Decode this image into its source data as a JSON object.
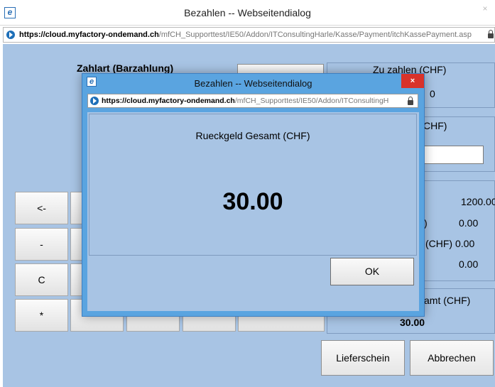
{
  "outer_window": {
    "title": "Bezahlen -- Webseitendialog",
    "close_glyph": "×",
    "url_domain": "https://cloud.myfactory-ondemand.ch",
    "url_path": "/mfCH_Supporttest/IE50/Addon/ITConsultingHarle/Kasse/Payment/itchKassePayment.asp"
  },
  "payment": {
    "payment_type_title": "Zahlart (Barzahlung)",
    "amount_due_label": "Zu zahlen (CHF)",
    "amount_due_value_partial": "0",
    "amount_received_label_partial": "CHF)",
    "summary_value_1": "1200.00",
    "summary_label_2_partial": ")",
    "summary_value_2": "0.00",
    "summary_label_3_partial": "(CHF) 0.00",
    "summary_value_4": "0.00",
    "change_total_label_partial": "amt (CHF)",
    "change_total_value": "30.00",
    "keypad": {
      "backspace": "<-",
      "minus": "-",
      "clear": "C",
      "multiply": "*"
    },
    "delivery_note_button": "Lieferschein",
    "cancel_button": "Abbrechen"
  },
  "inner_dialog": {
    "title": "Bezahlen -- Webseitendialog",
    "close_glyph": "×",
    "url_domain": "https://cloud.myfactory-ondemand.ch",
    "url_path": "/mfCH_Supporttest/IE50/Addon/ITConsultingH",
    "change_label": "Rueckgeld Gesamt (CHF)",
    "change_value": "30.00",
    "ok_button": "OK"
  },
  "colors": {
    "page_background": "#a8c4e4",
    "dialog_frame": "#5aa4e0",
    "close_button": "#d9322a",
    "site_icon": "#1e6fb8"
  },
  "icons": {
    "browser": "ie-icon",
    "site": "site-identity-icon",
    "secure": "lock-icon"
  }
}
